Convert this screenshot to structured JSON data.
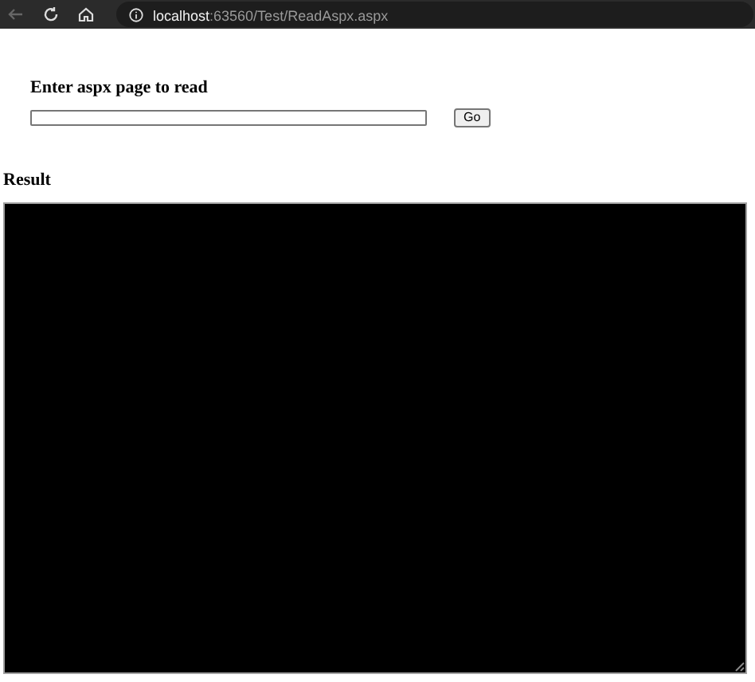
{
  "browser": {
    "url_host": "localhost",
    "url_path": ":63560/Test/ReadAspx.aspx"
  },
  "form": {
    "heading": "Enter aspx page to read",
    "button": "Go"
  },
  "result": {
    "heading": "Result"
  }
}
